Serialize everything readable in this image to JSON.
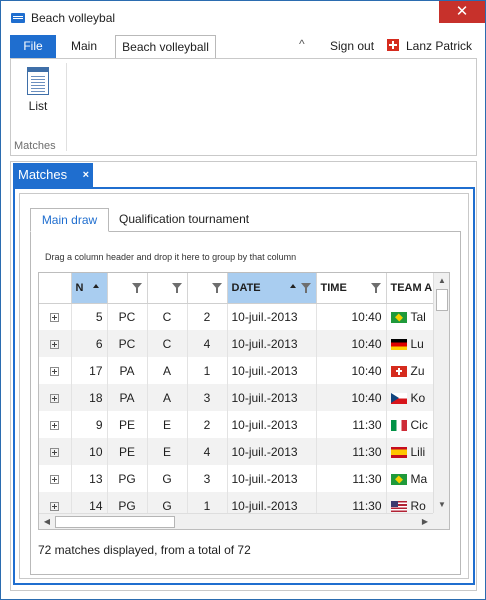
{
  "window": {
    "title": "Beach volleybal",
    "close_glyph": "✕"
  },
  "ribbon": {
    "file_tab": "File",
    "tabs": [
      "Main",
      "Beach volleyball"
    ],
    "collapse_glyph": "^",
    "sign_out": "Sign out",
    "user_name": "Lanz Patrick",
    "buttons": [
      {
        "label": "List",
        "icon": "list-icon"
      }
    ],
    "group_label": "Matches"
  },
  "document": {
    "tab_label": "Matches",
    "tab_close": "×",
    "sub_tabs": [
      "Main draw",
      "Qualification tournament"
    ],
    "group_hint": "Drag a column header and drop it here to group by that column",
    "status": "72 matches displayed, from a total of 72"
  },
  "grid": {
    "columns": [
      {
        "label": "",
        "filter": false,
        "sorted": false
      },
      {
        "label": "N",
        "filter": false,
        "sorted": true,
        "sort": "asc"
      },
      {
        "label": "",
        "filter": true,
        "sorted": false
      },
      {
        "label": "",
        "filter": true,
        "sorted": false
      },
      {
        "label": "",
        "filter": true,
        "sorted": false
      },
      {
        "label": "DATE",
        "filter": true,
        "sorted": true,
        "sort": "asc"
      },
      {
        "label": "TIME",
        "filter": true,
        "sorted": false
      },
      {
        "label": "TEAM A",
        "filter": false,
        "sorted": false
      }
    ],
    "rows": [
      {
        "no": "5",
        "c1": "PC",
        "c2": "C",
        "c3": "2",
        "date": "10-juil.-2013",
        "time": "10:40",
        "flag": "bra",
        "team": "Tal"
      },
      {
        "no": "6",
        "c1": "PC",
        "c2": "C",
        "c3": "4",
        "date": "10-juil.-2013",
        "time": "10:40",
        "flag": "ger",
        "team": "Lu"
      },
      {
        "no": "17",
        "c1": "PA",
        "c2": "A",
        "c3": "1",
        "date": "10-juil.-2013",
        "time": "10:40",
        "flag": "sui",
        "team": "Zu"
      },
      {
        "no": "18",
        "c1": "PA",
        "c2": "A",
        "c3": "3",
        "date": "10-juil.-2013",
        "time": "10:40",
        "flag": "cze",
        "team": "Ko"
      },
      {
        "no": "9",
        "c1": "PE",
        "c2": "E",
        "c3": "2",
        "date": "10-juil.-2013",
        "time": "11:30",
        "flag": "ita",
        "team": "Cic"
      },
      {
        "no": "10",
        "c1": "PE",
        "c2": "E",
        "c3": "4",
        "date": "10-juil.-2013",
        "time": "11:30",
        "flag": "esp",
        "team": "Lili"
      },
      {
        "no": "13",
        "c1": "PG",
        "c2": "G",
        "c3": "3",
        "date": "10-juil.-2013",
        "time": "11:30",
        "flag": "bra",
        "team": "Ma"
      },
      {
        "no": "14",
        "c1": "PG",
        "c2": "G",
        "c3": "1",
        "date": "10-juil.-2013",
        "time": "11:30",
        "flag": "usa",
        "team": "Ro"
      }
    ]
  },
  "colors": {
    "accent": "#1f6ecf",
    "sorted_header": "#a9cdf0",
    "close_red": "#c7312b"
  }
}
